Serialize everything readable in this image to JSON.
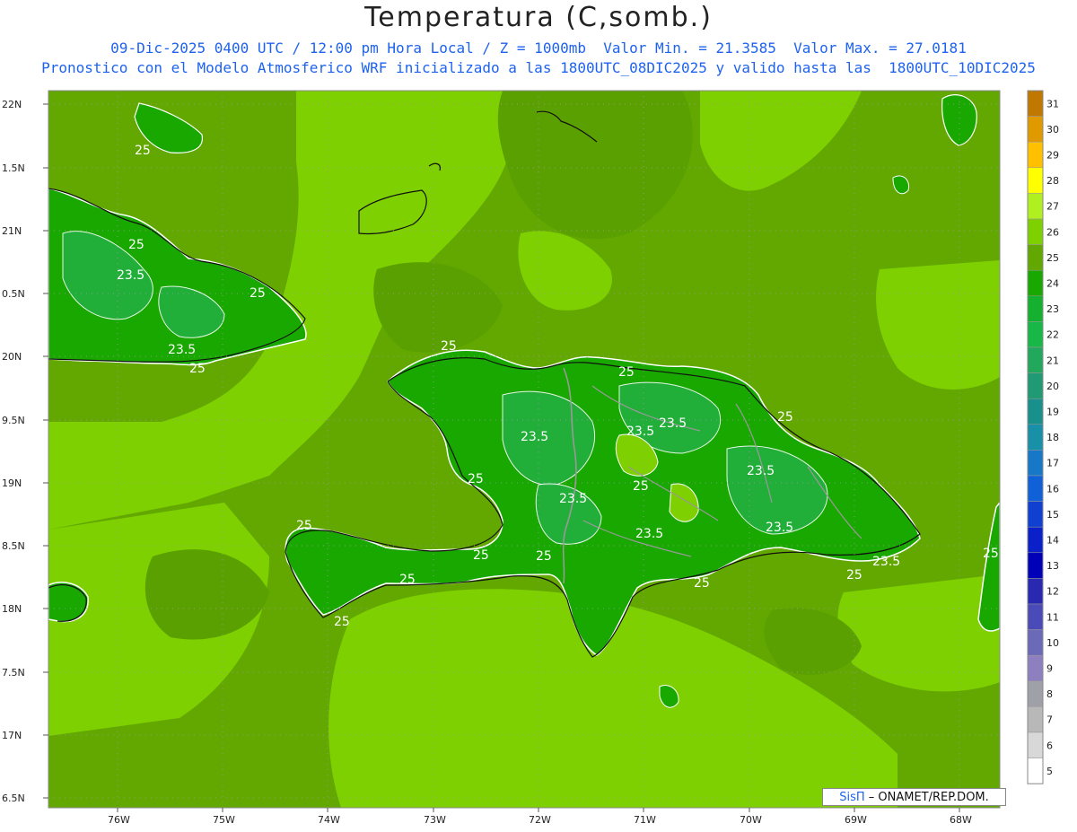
{
  "title": "Temperatura (C,somb.)",
  "subtitle_line1": "09-Dic-2025 0400 UTC / 12:00 pm Hora Local / Z = 1000mb  Valor Min. = 21.3585  Valor Max. = 27.0181",
  "subtitle_line2": "Pronostico con el Modelo Atmosferico WRF inicializado a las 1800UTC_08DIC2025 y valido hasta las  1800UTC_10DIC2025",
  "credit": {
    "brand": "SisΠ",
    "text": " – ONAMET/REP.DOM."
  },
  "latitude_ticks": [
    "22N",
    "1.5N",
    "21N",
    "0.5N",
    "20N",
    "9.5N",
    "19N",
    "8.5N",
    "18N",
    "7.5N",
    "17N",
    "6.5N"
  ],
  "longitude_ticks": [
    "76W",
    "75W",
    "74W",
    "73W",
    "72W",
    "71W",
    "70W",
    "69W",
    "68W"
  ],
  "colorbar": {
    "levels": [
      "31",
      "30",
      "29",
      "28",
      "27",
      "26",
      "25",
      "24",
      "23",
      "22",
      "21",
      "20",
      "19",
      "18",
      "17",
      "16",
      "15",
      "14",
      "13",
      "12",
      "11",
      "10",
      "9",
      "8",
      "7",
      "6",
      "5"
    ],
    "colors": [
      "#c07800",
      "#e09a00",
      "#ffc000",
      "#ffff00",
      "#b0f020",
      "#7ed000",
      "#62a800",
      "#18a800",
      "#16b030",
      "#18b848",
      "#22a85c",
      "#1f9a72",
      "#18908c",
      "#1890a8",
      "#1878c8",
      "#1060d8",
      "#0f40d0",
      "#0a20c8",
      "#0000b8",
      "#2828b0",
      "#4a4ab8",
      "#6a6ab8",
      "#8e80c0",
      "#a0a0a8",
      "#b8b8b8",
      "#d8d8d8",
      "#ffffff"
    ]
  },
  "field_colors": {
    "sea": "#62a800",
    "band": "#7ed000",
    "land": "#18a800",
    "land_dark": "#16b030"
  },
  "contour_labels": [
    {
      "text": "25"
    },
    {
      "text": "25"
    },
    {
      "text": "23.5"
    },
    {
      "text": "25"
    },
    {
      "text": "23.5"
    },
    {
      "text": "25"
    },
    {
      "text": "25"
    },
    {
      "text": "23.5"
    },
    {
      "text": "25"
    },
    {
      "text": "25"
    },
    {
      "text": "23.5"
    },
    {
      "text": "23.5"
    },
    {
      "text": "23.5"
    },
    {
      "text": "25"
    },
    {
      "text": "23.5"
    },
    {
      "text": "23.5"
    },
    {
      "text": "25"
    },
    {
      "text": "25"
    },
    {
      "text": "25"
    },
    {
      "text": "25"
    },
    {
      "text": "25"
    },
    {
      "text": "25"
    },
    {
      "text": "23.5"
    },
    {
      "text": "23.5"
    },
    {
      "text": "25"
    },
    {
      "text": "25"
    },
    {
      "text": "25"
    }
  ]
}
